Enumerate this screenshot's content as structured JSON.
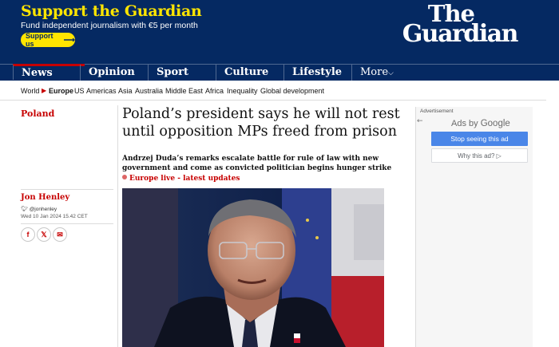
{
  "support": {
    "title": "Support the Guardian",
    "subtitle": "Fund independent journalism with €5 per month",
    "button_label": "Support us",
    "button_arrow": "⟶"
  },
  "logo": {
    "line1": "The",
    "line2": "Guardian"
  },
  "nav": {
    "items": [
      {
        "label": "News",
        "active": true
      },
      {
        "label": "Opinion"
      },
      {
        "label": "Sport"
      },
      {
        "label": "Culture"
      },
      {
        "label": "Lifestyle"
      },
      {
        "label": "More",
        "chevron": "⌵"
      }
    ]
  },
  "subnav": {
    "items": [
      "World",
      "Europe",
      "US",
      "Americas",
      "Asia",
      "Australia",
      "Middle East",
      "Africa",
      "Inequality",
      "Global development"
    ],
    "selected": "Europe",
    "marker": "▶"
  },
  "article": {
    "section": "Poland",
    "headline_line1": "Poland’s president says he will not rest",
    "headline_line2": "until opposition MPs freed from prison",
    "standfirst_line1": "Andrzej Duda’s remarks escalate battle for rule of law with new",
    "standfirst_line2": "government and come as convicted politician begins hunger strike",
    "live_link": "Europe live - latest updates",
    "author": "Jon Henley",
    "twitter_handle": "@jonhenley",
    "date": "Wed 10 Jan 2024 15.42 CET",
    "share": {
      "facebook": "f",
      "twitter": "𝕏",
      "email": "✉"
    }
  },
  "ad": {
    "label": "Advertisement",
    "back_arrow": "←",
    "ads_by": "Ads by",
    "google": "Google",
    "stop_label": "Stop seeing this ad",
    "why_label": "Why this ad?",
    "why_icon": "▷"
  },
  "colors": {
    "brand_blue": "#052962",
    "support_yellow": "#ffe500",
    "news_red": "#c70000",
    "ad_blue": "#4a86e8"
  }
}
